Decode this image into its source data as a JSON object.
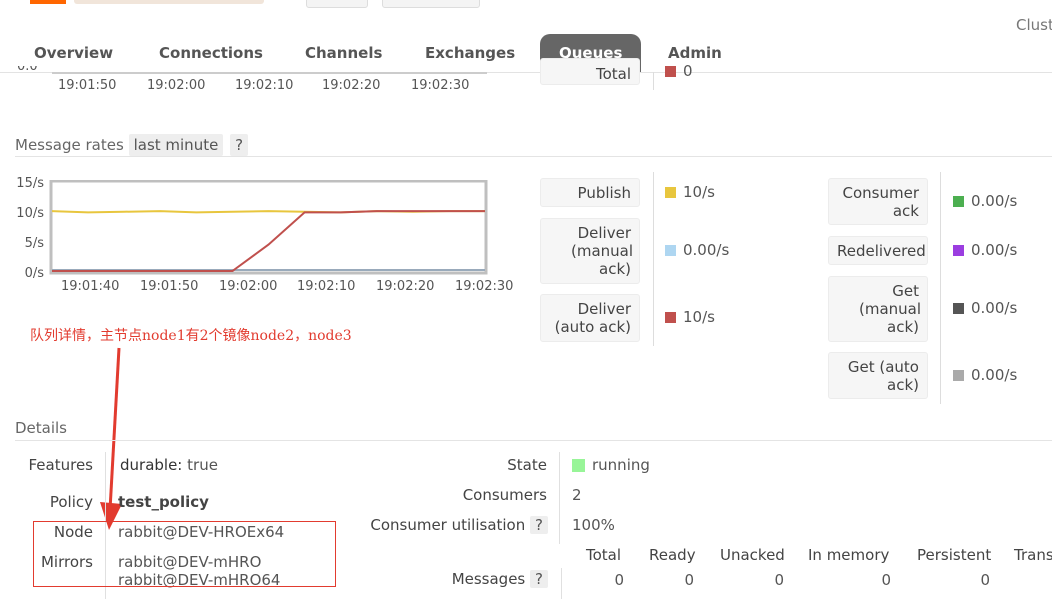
{
  "header": {
    "cluster_text": "Clust"
  },
  "nav": {
    "tabs": [
      {
        "label": "Overview"
      },
      {
        "label": "Connections"
      },
      {
        "label": "Channels"
      },
      {
        "label": "Exchanges"
      },
      {
        "label": "Queues"
      },
      {
        "label": "Admin"
      }
    ],
    "active": "Queues"
  },
  "queued_chart": {
    "y_tick_partial": "0.0",
    "x_ticks": [
      "19:01:50",
      "19:02:00",
      "19:02:10",
      "19:02:20",
      "19:02:30"
    ],
    "legend_partial_label": "Total",
    "legend_partial_value": "0",
    "legend_partial_color": "#c0504d"
  },
  "message_rates": {
    "title": "Message rates",
    "range_label": "last minute",
    "help": "?",
    "y_ticks": [
      "15/s",
      "10/s",
      "5/s",
      "0/s"
    ],
    "x_ticks": [
      "19:01:40",
      "19:01:50",
      "19:02:00",
      "19:02:10",
      "19:02:20",
      "19:02:30"
    ],
    "legend_left": [
      {
        "label": "Publish",
        "value": "10/s",
        "color": "#e8c63e"
      },
      {
        "label": "Deliver (manual ack)",
        "value": "0.00/s",
        "color": "#aed6f1"
      },
      {
        "label": "Deliver (auto ack)",
        "value": "10/s",
        "color": "#c0504d"
      }
    ],
    "legend_right": [
      {
        "label": "Consumer ack",
        "value": "0.00/s",
        "color": "#4caf50"
      },
      {
        "label": "Redelivered",
        "value": "0.00/s",
        "color": "#9b3de0"
      },
      {
        "label": "Get (manual ack)",
        "value": "0.00/s",
        "color": "#555555"
      },
      {
        "label": "Get (auto ack)",
        "value": "0.00/s",
        "color": "#aaaaaa"
      }
    ]
  },
  "chart_data": {
    "type": "line",
    "x": [
      "19:01:35",
      "19:01:40",
      "19:01:45",
      "19:01:50",
      "19:01:55",
      "19:02:00",
      "19:02:05",
      "19:02:10",
      "19:02:15",
      "19:02:20",
      "19:02:25",
      "19:02:30",
      "19:02:35"
    ],
    "series": [
      {
        "name": "Publish",
        "color": "#e8c63e",
        "values": [
          10.2,
          10,
          10.1,
          10.2,
          10,
          10.1,
          10.2,
          10.1,
          10,
          10.2,
          10.1,
          10.2,
          10.2
        ]
      },
      {
        "name": "Deliver (auto ack)",
        "color": "#c0504d",
        "values": [
          0,
          0,
          0,
          0,
          0,
          0,
          4.5,
          10,
          10,
          10.2,
          10.2,
          10.2,
          10.2
        ]
      }
    ],
    "x_ticks": [
      "19:01:40",
      "19:01:50",
      "19:02:00",
      "19:02:10",
      "19:02:20",
      "19:02:30"
    ],
    "y_ticks": [
      "15/s",
      "10/s",
      "5/s",
      "0/s"
    ],
    "ylim": [
      0,
      15
    ]
  },
  "annotation": {
    "text": "队列详情，主节点node1有2个镜像node2，node3"
  },
  "details": {
    "title": "Details",
    "features_key": "Features",
    "features_name": "durable:",
    "features_value": "true",
    "policy_key": "Policy",
    "policy_value": "test_policy",
    "node_key": "Node",
    "node_value": "rabbit@DEV-HROEx64",
    "mirrors_key": "Mirrors",
    "mirrors": [
      "rabbit@DEV-mHRO",
      "rabbit@DEV-mHRO64"
    ],
    "state_key": "State",
    "state_value": "running",
    "state_color": "#98f598",
    "consumers_key": "Consumers",
    "consumers_value": "2",
    "utilisation_key": "Consumer utilisation",
    "utilisation_help": "?",
    "utilisation_value": "100%",
    "messages_key": "Messages",
    "messages_help": "?",
    "messages_headers": [
      "Total",
      "Ready",
      "Unacked",
      "In memory",
      "Persistent",
      "Trans"
    ],
    "messages_values": [
      "0",
      "0",
      "0",
      "0",
      "0"
    ]
  }
}
